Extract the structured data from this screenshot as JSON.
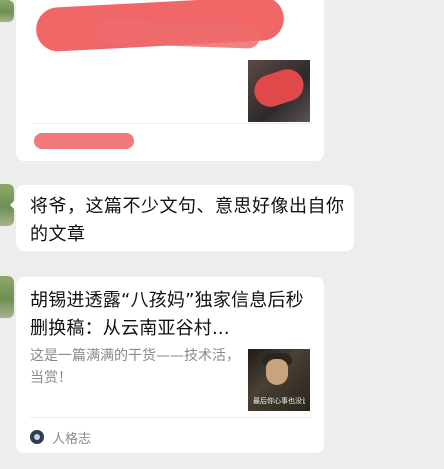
{
  "chat": {
    "messages": [
      {
        "type": "redacted_card"
      },
      {
        "type": "text",
        "text": "将爷，这篇不少文句、意思好像出自你的文章"
      },
      {
        "type": "article_card",
        "title": "胡锡进透露“八孩妈”独家信息后秒删换稿：从云南亚谷村...",
        "description": "这是一篇满满的干货——技术活，当赏！",
        "thumbnail_caption": "最后你心事也没说出来",
        "source_name": "人格志"
      }
    ]
  },
  "icons": {
    "source_icon": "account-logo-icon"
  }
}
